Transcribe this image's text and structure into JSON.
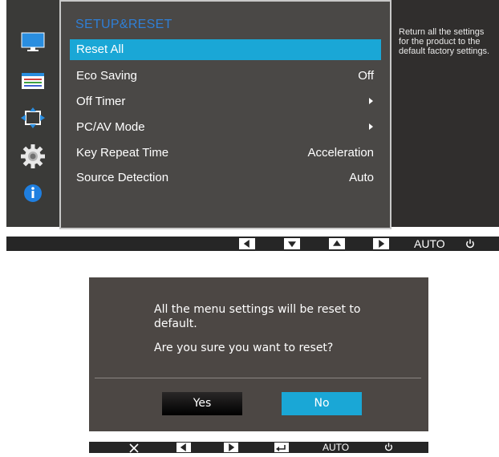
{
  "osd": {
    "title": "SETUP&RESET",
    "items": [
      {
        "label": "Reset All",
        "value": "",
        "selected": true
      },
      {
        "label": "Eco Saving",
        "value": "Off"
      },
      {
        "label": "Off Timer",
        "value": "",
        "submenu": true
      },
      {
        "label": "PC/AV Mode",
        "value": "",
        "submenu": true
      },
      {
        "label": "Key Repeat Time",
        "value": "Acceleration"
      },
      {
        "label": "Source Detection",
        "value": "Auto"
      }
    ],
    "help_text": "Return all the settings\nfor the product to the\ndefault factory settings.",
    "side_icons": [
      "picture-icon",
      "color-icon",
      "size-position-icon",
      "setup-gear-icon",
      "information-icon"
    ],
    "selected_color": "#1aa7d6",
    "title_color": "#2f7fd6"
  },
  "control_bar_top": {
    "buttons": [
      "left-icon",
      "down-icon",
      "up-icon",
      "right-icon"
    ],
    "auto_label": "AUTO",
    "power_icon": "power-icon"
  },
  "dialog": {
    "message": "All the menu settings will be reset to default.",
    "question": "Are you sure you want to reset?",
    "yes_label": "Yes",
    "no_label": "No",
    "focused": "No"
  },
  "control_bar_bottom": {
    "buttons": [
      "close-icon",
      "left-icon",
      "right-icon",
      "enter-icon"
    ],
    "auto_label": "AUTO",
    "power_icon": "power-icon"
  }
}
